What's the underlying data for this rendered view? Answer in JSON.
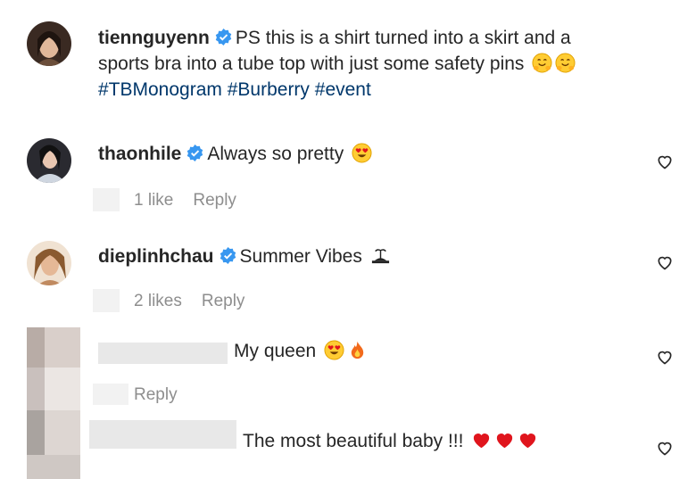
{
  "comments": [
    {
      "username": "tiennguyenn",
      "text_line1": "PS this is a shirt turned into a skirt and a",
      "text_line2": "sports bra into a tube top with just some safety pins",
      "hashtags": "#TBMonogram #Burberry #event",
      "emojis": [
        "hugging-face",
        "hugging-face"
      ]
    },
    {
      "username": "thaonhile",
      "text": "Always so pretty",
      "emojis": [
        "heart-eyes-face"
      ],
      "likes": "1 like",
      "reply": "Reply"
    },
    {
      "username": "dieplinhchau",
      "text": "Summer Vibes",
      "emojis": [
        "island"
      ],
      "likes": "2 likes",
      "reply": "Reply"
    },
    {
      "username": "",
      "text": "My queen",
      "emojis": [
        "heart-eyes-face",
        "fire"
      ],
      "reply": "Reply"
    },
    {
      "username": "",
      "text": "The most beautiful baby !!!",
      "emojis": [
        "red-heart",
        "red-heart",
        "red-heart"
      ]
    }
  ],
  "colors": {
    "verified": "#3897f0",
    "hashtag": "#00376b",
    "meta": "#8e8e8e",
    "heart_red": "#e0151d"
  }
}
